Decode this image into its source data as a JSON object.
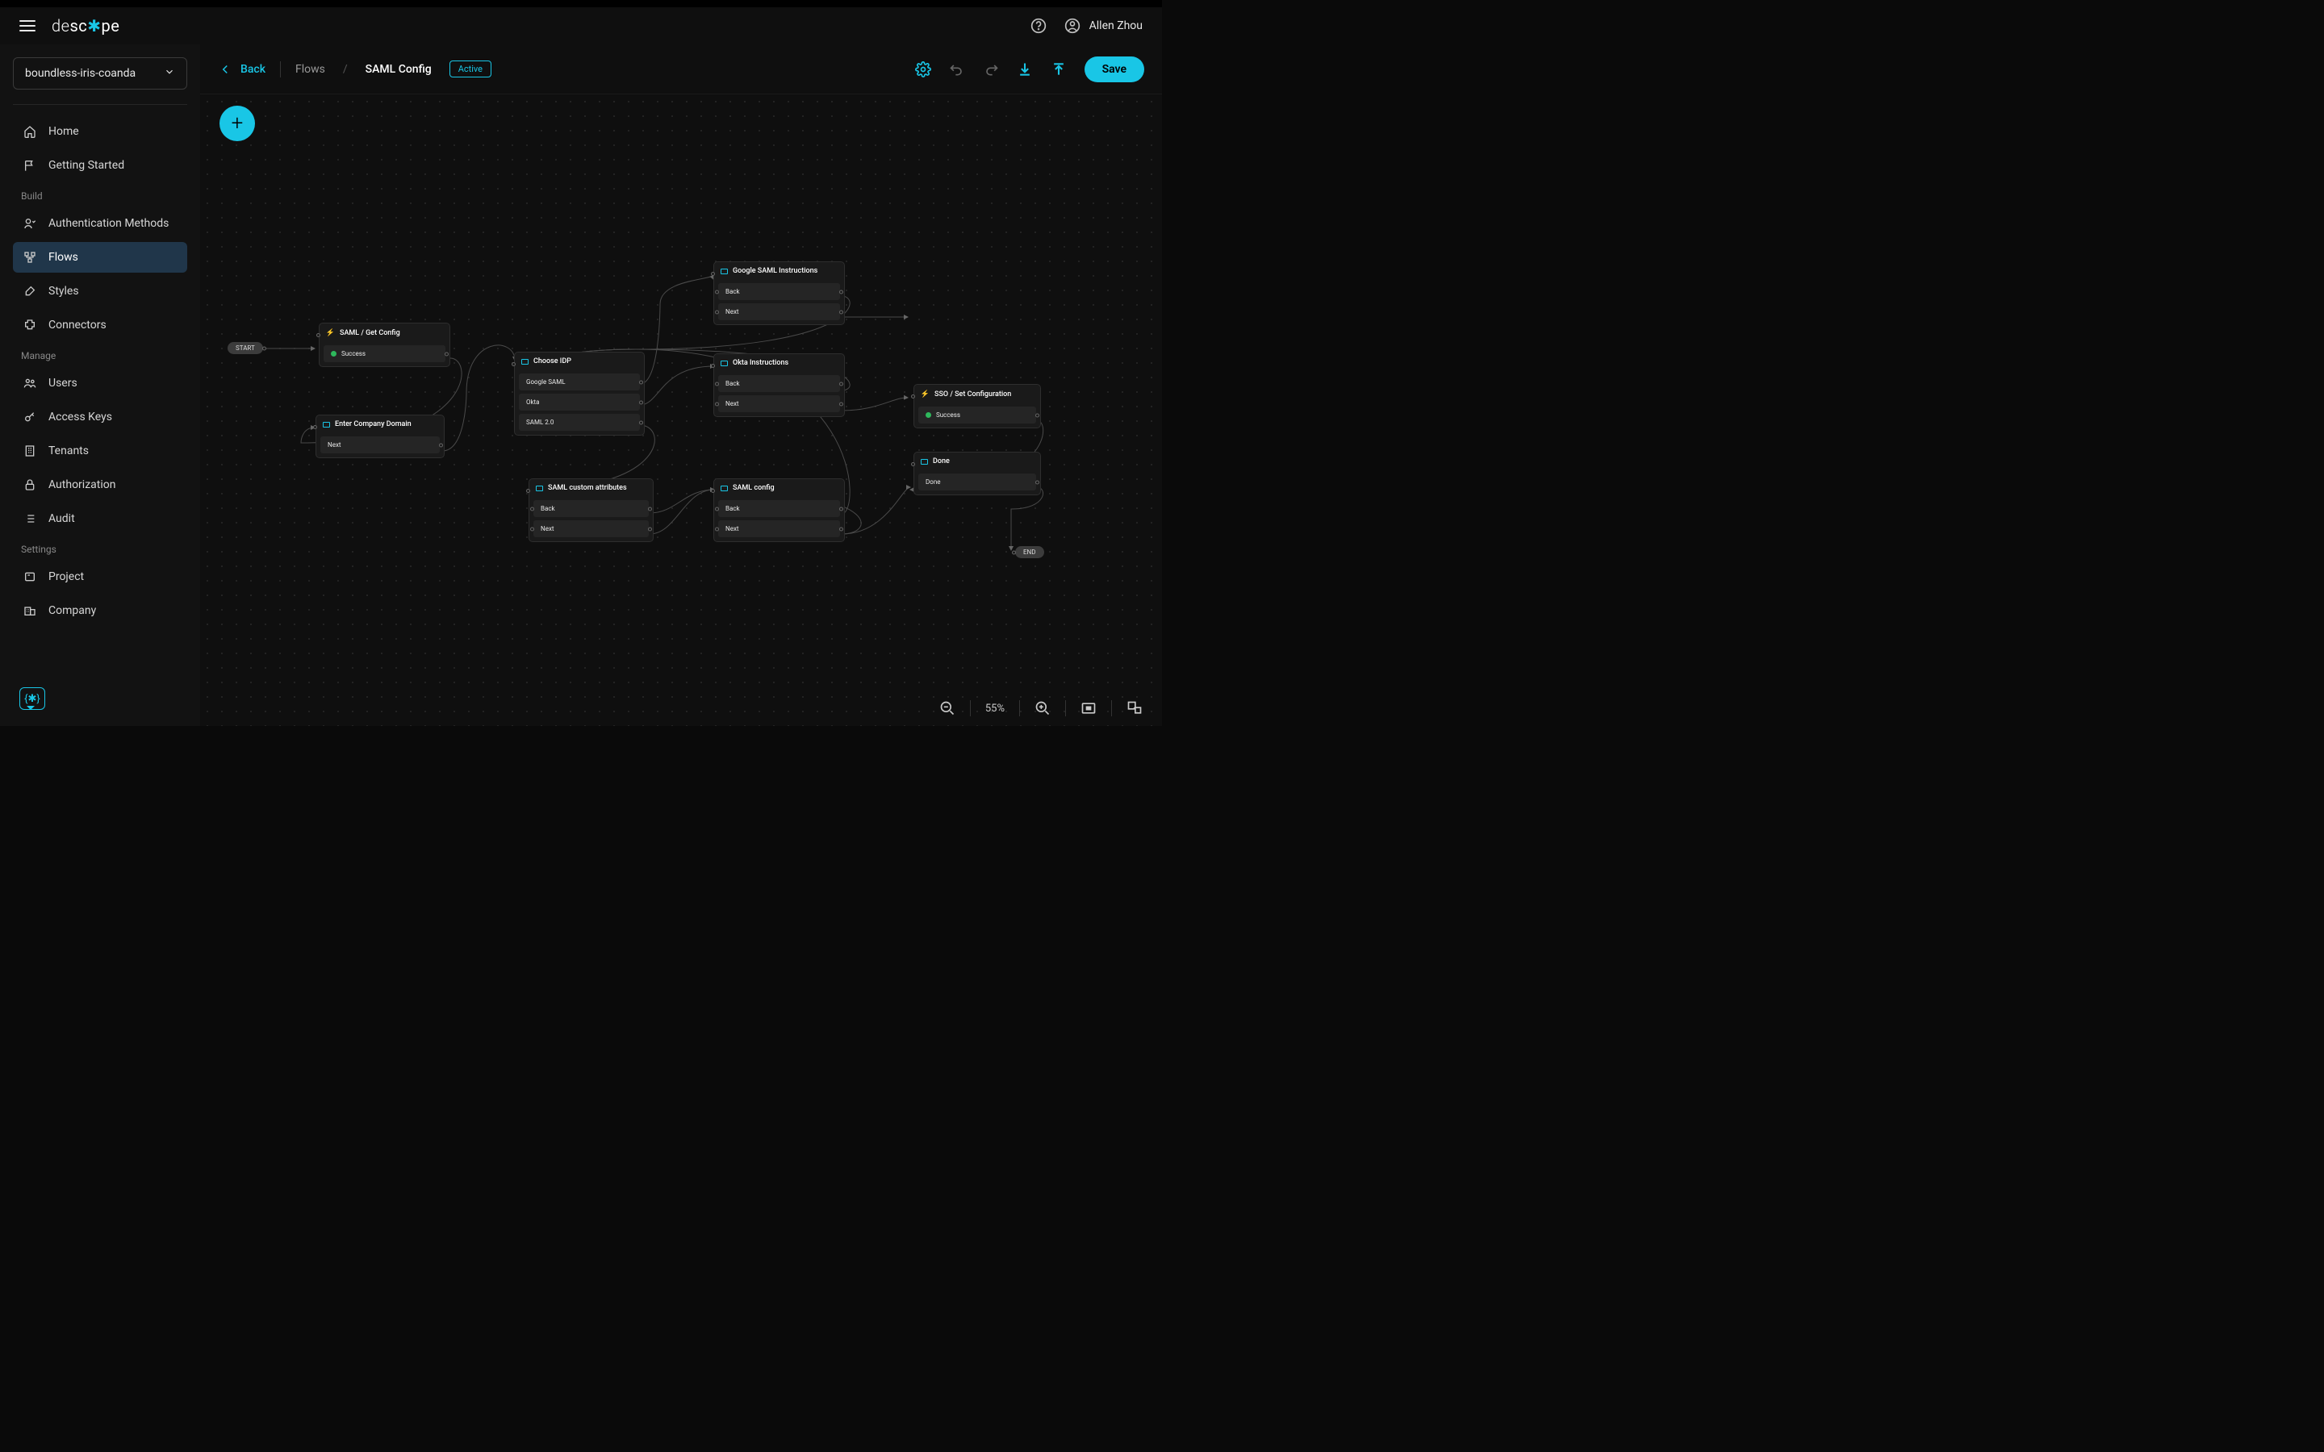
{
  "brand": {
    "pre": "de",
    "accent_left": "sc",
    "star": "✱",
    "accent_right": "pe"
  },
  "user": {
    "name": "Allen Zhou"
  },
  "project": {
    "name": "boundless-iris-coanda"
  },
  "sidebar": {
    "items_top": [
      {
        "label": "Home"
      },
      {
        "label": "Getting Started"
      }
    ],
    "section_build": "Build",
    "items_build": [
      {
        "label": "Authentication Methods"
      },
      {
        "label": "Flows"
      },
      {
        "label": "Styles"
      },
      {
        "label": "Connectors"
      }
    ],
    "section_manage": "Manage",
    "items_manage": [
      {
        "label": "Users"
      },
      {
        "label": "Access Keys"
      },
      {
        "label": "Tenants"
      },
      {
        "label": "Authorization"
      },
      {
        "label": "Audit"
      }
    ],
    "section_settings": "Settings",
    "items_settings": [
      {
        "label": "Project"
      },
      {
        "label": "Company"
      }
    ]
  },
  "header": {
    "back": "Back",
    "crumb_root": "Flows",
    "crumb_current": "SAML Config",
    "status": "Active",
    "save": "Save"
  },
  "zoom": {
    "level": "55%"
  },
  "flow": {
    "start": "START",
    "end": "END",
    "nodes": {
      "get_config": {
        "title": "SAML / Get Config",
        "row": "Success"
      },
      "enter_domain": {
        "title": "Enter Company Domain",
        "row": "Next"
      },
      "choose_idp": {
        "title": "Choose IDP",
        "r1": "Google SAML",
        "r2": "Okta",
        "r3": "SAML 2.0"
      },
      "google_instr": {
        "title": "Google SAML Instructions",
        "r1": "Back",
        "r2": "Next"
      },
      "okta_instr": {
        "title": "Okta Instructions",
        "r1": "Back",
        "r2": "Next"
      },
      "saml_custom": {
        "title": "SAML custom attributes",
        "r1": "Back",
        "r2": "Next"
      },
      "saml_config": {
        "title": "SAML config",
        "r1": "Back",
        "r2": "Next"
      },
      "sso_set": {
        "title": "SSO / Set Configuration",
        "row": "Success"
      },
      "done": {
        "title": "Done",
        "row": "Done"
      }
    }
  }
}
